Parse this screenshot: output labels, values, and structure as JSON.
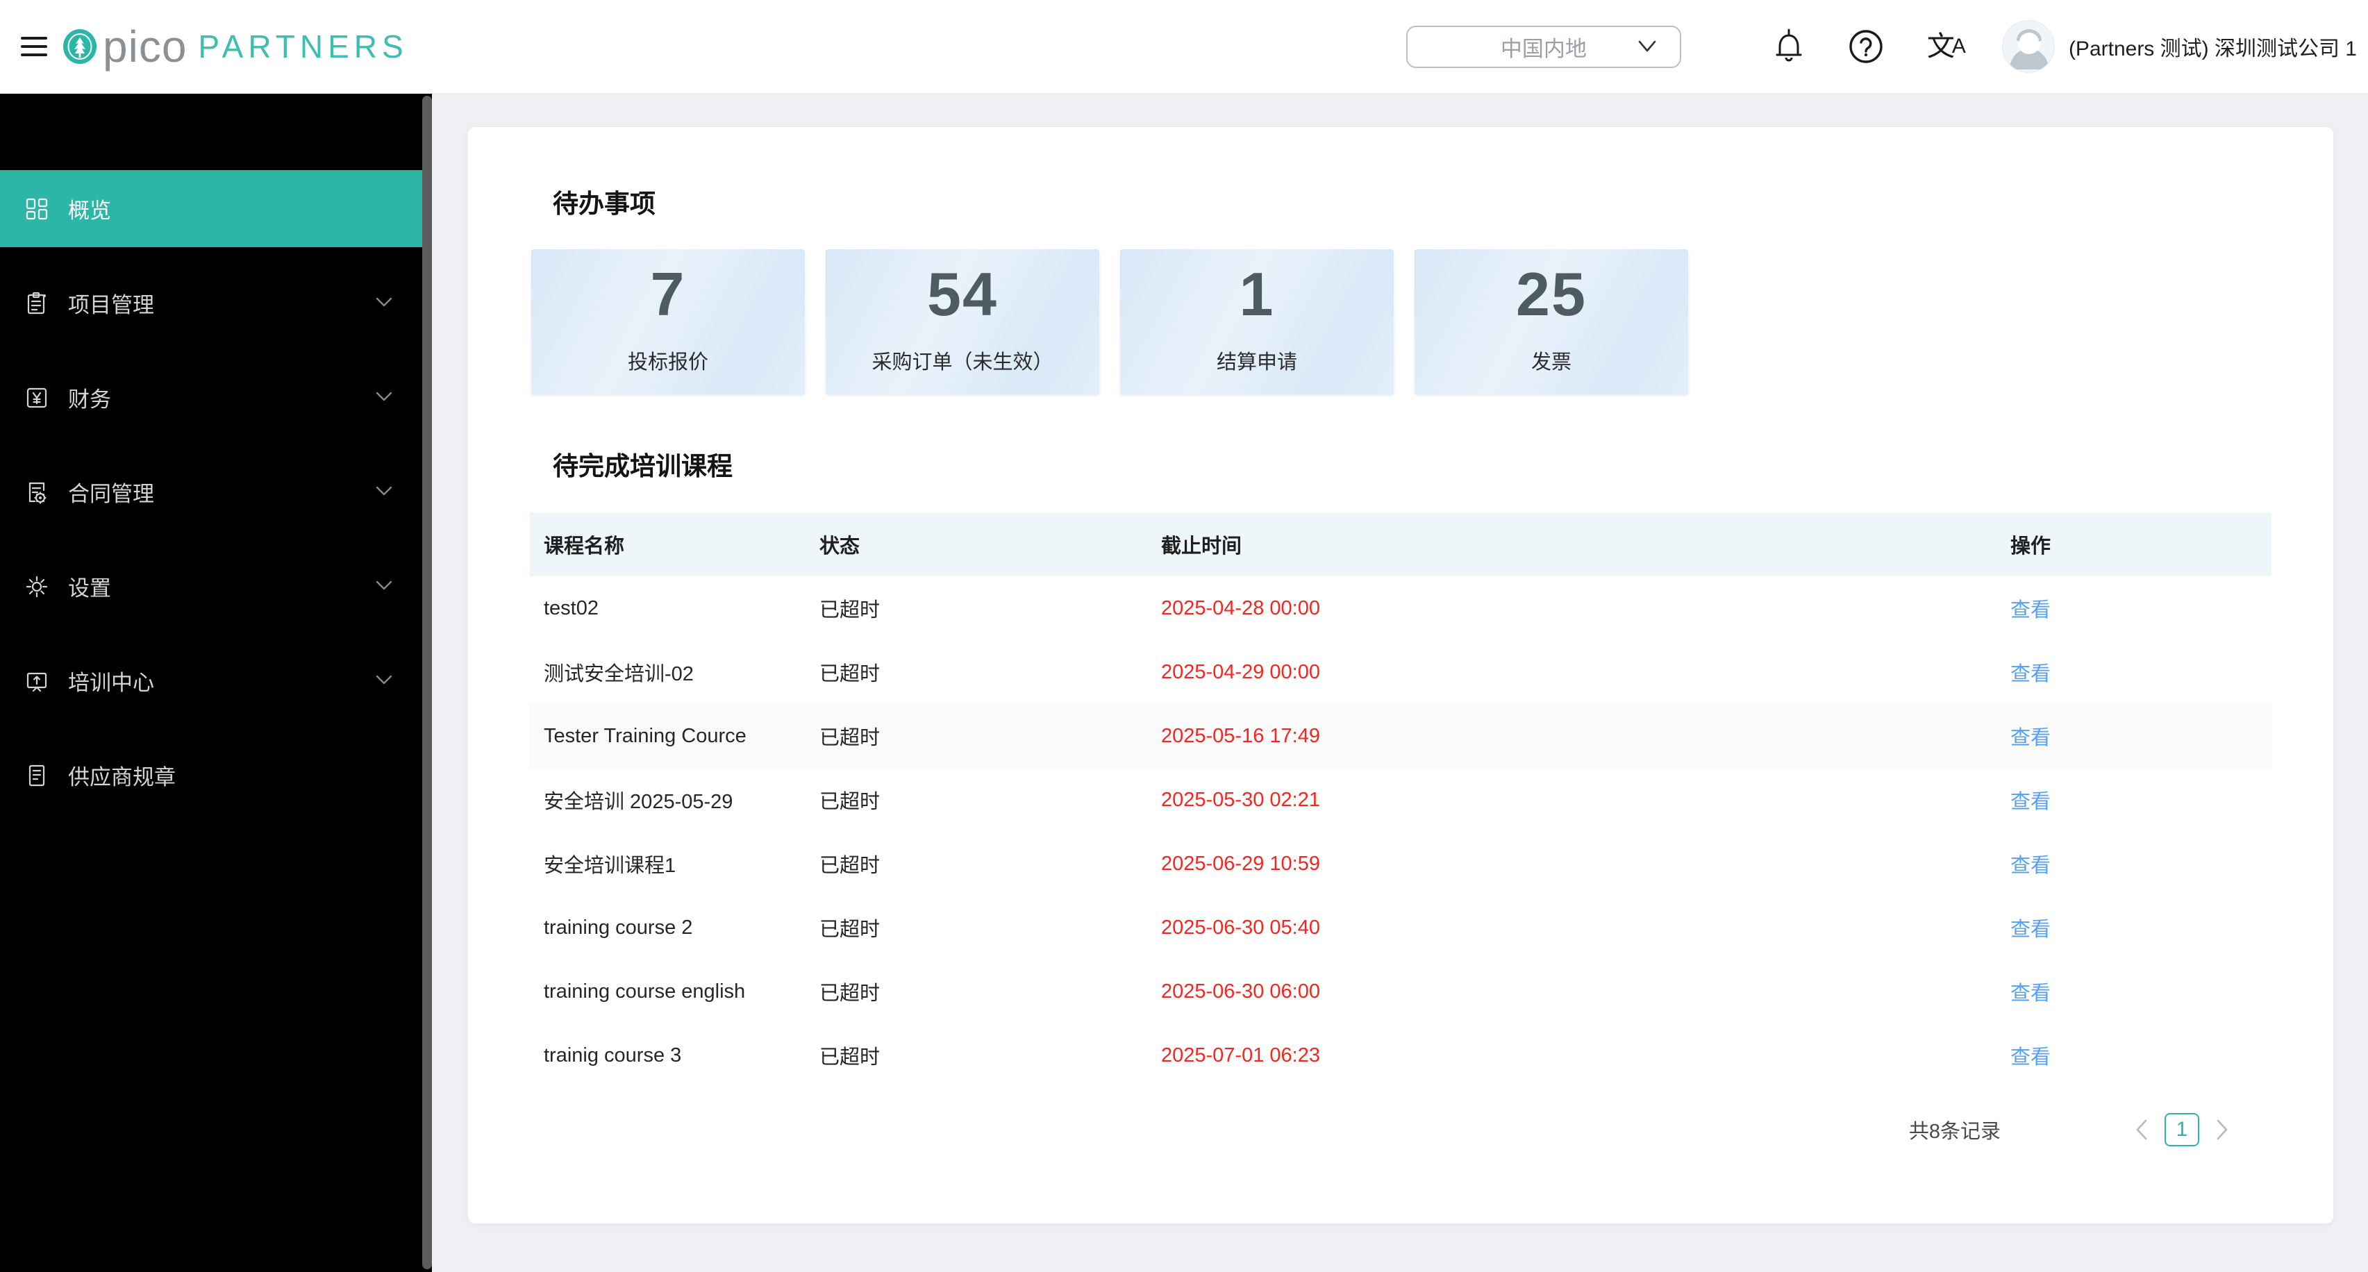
{
  "brand": {
    "logo_pico": "pico",
    "logo_partners": "PARTNERS"
  },
  "header": {
    "region_selector": {
      "value": "中国内地"
    },
    "translate_icon": {
      "zh": "文",
      "en": "A"
    },
    "user": {
      "name": "(Partners 测试) 深圳测试公司 1"
    }
  },
  "colors": {
    "accent_teal": "#2bb6a7",
    "danger_red": "#f5261f",
    "link_blue": "#54a0f5",
    "sidebar_bg": "#000000",
    "table_header_bg": "#eff6fa"
  },
  "sidebar": {
    "items": [
      {
        "label": "概览",
        "icon": "overview-grid-icon",
        "active": true,
        "expandable": false
      },
      {
        "label": "项目管理",
        "icon": "projects-clipboard-icon",
        "active": false,
        "expandable": true
      },
      {
        "label": "财务",
        "icon": "finance-yen-icon",
        "active": false,
        "expandable": true
      },
      {
        "label": "合同管理",
        "icon": "contract-doc-gear-icon",
        "active": false,
        "expandable": true
      },
      {
        "label": "设置",
        "icon": "settings-gear-icon",
        "active": false,
        "expandable": true
      },
      {
        "label": "培训中心",
        "icon": "training-center-icon",
        "active": false,
        "expandable": true
      },
      {
        "label": "供应商规章",
        "icon": "supplier-rules-doc-icon",
        "active": false,
        "expandable": false
      }
    ]
  },
  "todo": {
    "title": "待办事项",
    "cards": [
      {
        "value": "7",
        "label": "投标报价"
      },
      {
        "value": "54",
        "label": "采购订单（未生效）"
      },
      {
        "value": "1",
        "label": "结算申请"
      },
      {
        "value": "25",
        "label": "发票"
      }
    ]
  },
  "training": {
    "title": "待完成培训课程",
    "columns": [
      "课程名称",
      "状态",
      "截止时间",
      "操作"
    ],
    "action_label": "查看",
    "rows": [
      {
        "name": "test02",
        "status": "已超时",
        "deadline": "2025-04-28 00:00"
      },
      {
        "name": "测试安全培训-02",
        "status": "已超时",
        "deadline": "2025-04-29 00:00"
      },
      {
        "name": "Tester Training Cource",
        "status": "已超时",
        "deadline": "2025-05-16 17:49"
      },
      {
        "name": "安全培训 2025-05-29",
        "status": "已超时",
        "deadline": "2025-05-30 02:21"
      },
      {
        "name": "安全培训课程1",
        "status": "已超时",
        "deadline": "2025-06-29 10:59"
      },
      {
        "name": "training course 2",
        "status": "已超时",
        "deadline": "2025-06-30 05:40"
      },
      {
        "name": "training course english",
        "status": "已超时",
        "deadline": "2025-06-30 06:00"
      },
      {
        "name": "trainig course 3",
        "status": "已超时",
        "deadline": "2025-07-01 06:23"
      }
    ],
    "pagination": {
      "total": "共8条记录",
      "page": "1"
    }
  }
}
